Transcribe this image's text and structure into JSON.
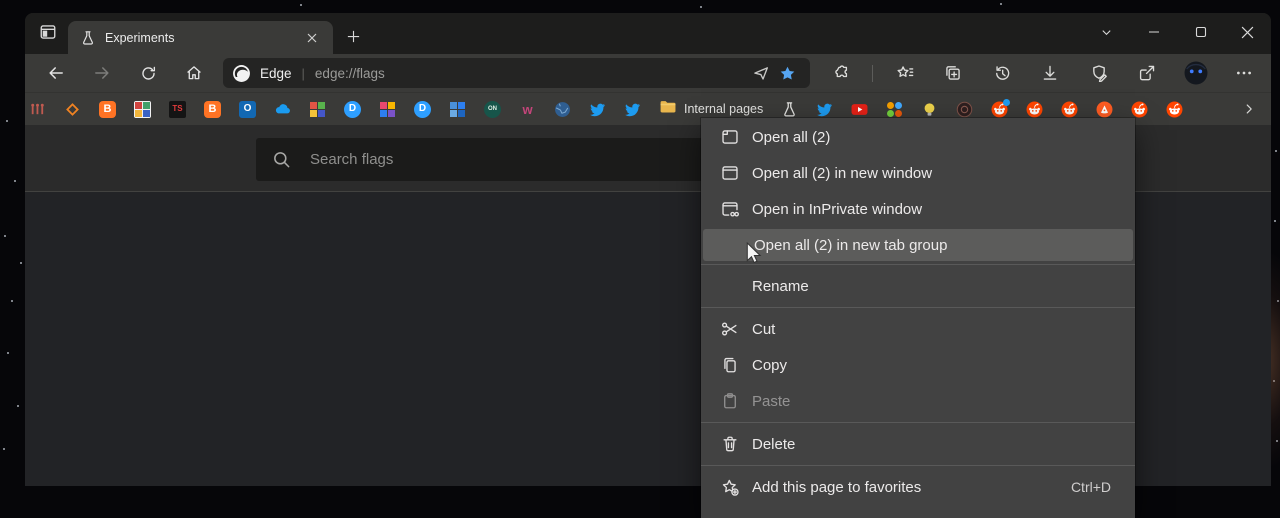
{
  "window": {
    "tab_title": "Experiments",
    "toolbar": {
      "site_label": "Edge",
      "url": "edge://flags",
      "right_icons": [
        {
          "name": "extensions-icon",
          "icon": "puzzle"
        },
        {
          "name": "toolbar-divider",
          "icon": "divider"
        },
        {
          "name": "favorites-icon",
          "icon": "starlines"
        },
        {
          "name": "collections-icon",
          "icon": "collections"
        },
        {
          "name": "history-icon",
          "icon": "history"
        },
        {
          "name": "downloads-icon",
          "icon": "download"
        },
        {
          "name": "browser-essentials-icon",
          "icon": "shieldpencil"
        },
        {
          "name": "share-icon",
          "icon": "share"
        },
        {
          "name": "profile-avatar",
          "icon": "avatar"
        },
        {
          "name": "settings-menu-icon",
          "icon": "dots"
        }
      ]
    }
  },
  "bookmarks_bar": {
    "folder_label": "Internal pages",
    "favicons_before_folder": [
      {
        "name": "matchsticks-favicon",
        "render": {
          "type": "icon",
          "icon": "pins"
        }
      },
      {
        "name": "orange-diamond-favicon",
        "render": {
          "type": "icon",
          "icon": "diamond"
        }
      },
      {
        "name": "blogger-favicon",
        "render": {
          "type": "text",
          "bg": "#ff7324",
          "fg": "#ffffff",
          "text": "B",
          "radius": "4px",
          "size": "11px",
          "bold": true
        }
      },
      {
        "name": "mosaic-thumbnail-favicon",
        "render": {
          "type": "grid",
          "colors": [
            "#d0443f",
            "#43a06a",
            "#f2b63c",
            "#3a62c4"
          ],
          "bg": "#f2f2f2"
        }
      },
      {
        "name": "ts-favicon",
        "render": {
          "type": "text",
          "bg": "#141414",
          "fg": "#e23b3b",
          "text": "TS",
          "radius": "2px",
          "size": "8px",
          "bold": true
        }
      },
      {
        "name": "blogger2-favicon",
        "render": {
          "type": "text",
          "bg": "#ff7324",
          "fg": "#ffffff",
          "text": "B",
          "radius": "4px",
          "size": "11px",
          "bold": true
        }
      },
      {
        "name": "outlook-favicon",
        "render": {
          "type": "text",
          "bg": "#1268b3",
          "fg": "#ffffff",
          "text": "O",
          "radius": "3px",
          "size": "10px",
          "bold": true
        }
      },
      {
        "name": "onedrive-favicon",
        "render": {
          "type": "icon",
          "icon": "cloud"
        }
      },
      {
        "name": "mosaic2-favicon",
        "render": {
          "type": "grid",
          "colors": [
            "#e05545",
            "#58b24c",
            "#f4c23a",
            "#4456c8"
          ]
        }
      },
      {
        "name": "disqus-favicon",
        "render": {
          "type": "text",
          "bg": "#2e9fff",
          "fg": "#ffffff",
          "text": "D",
          "radius": "50%",
          "size": "10px",
          "bold": true
        }
      },
      {
        "name": "color-squares-favicon",
        "render": {
          "type": "grid",
          "colors": [
            "#e8486e",
            "#f7b500",
            "#2d7ff0",
            "#7a52c7"
          ]
        }
      },
      {
        "name": "disqus2-favicon",
        "render": {
          "type": "text",
          "bg": "#2e9fff",
          "fg": "#ffffff",
          "text": "D",
          "radius": "50%",
          "size": "10px",
          "bold": true
        }
      },
      {
        "name": "microsoft-squares-favicon",
        "render": {
          "type": "grid",
          "colors": [
            "#4a90d9",
            "#2d7ff0",
            "#6aaae4",
            "#1d65c0"
          ]
        }
      },
      {
        "name": "on-circle-favicon",
        "render": {
          "type": "text",
          "bg": "#17554a",
          "fg": "#dff0e6",
          "text": "ON",
          "radius": "50%",
          "size": "6px",
          "bold": true
        }
      },
      {
        "name": "w-colorful-favicon",
        "render": {
          "type": "text",
          "bg": "transparent",
          "fg": "#c4457a",
          "text": "w",
          "radius": "0",
          "size": "13px",
          "bold": true
        }
      },
      {
        "name": "globe-favicon",
        "render": {
          "type": "icon",
          "icon": "globe"
        }
      },
      {
        "name": "twitter-favicon",
        "render": {
          "type": "icon",
          "icon": "bird"
        }
      },
      {
        "name": "twitter2-favicon",
        "render": {
          "type": "icon",
          "icon": "bird"
        }
      }
    ],
    "favicons_after_folder": [
      {
        "name": "flags-beaker-favicon",
        "render": {
          "type": "icon",
          "icon": "beaker"
        }
      },
      {
        "name": "twitter3-favicon",
        "render": {
          "type": "icon",
          "icon": "bird"
        }
      },
      {
        "name": "youtube-favicon",
        "render": {
          "type": "icon",
          "icon": "youtube"
        }
      },
      {
        "name": "people-group-favicon",
        "render": {
          "type": "grid",
          "colors": [
            "#f59f00",
            "#40a9ff",
            "#73d13d",
            "#e8590c"
          ],
          "round": true
        }
      },
      {
        "name": "lightbulb-favicon",
        "render": {
          "type": "icon",
          "icon": "bulb"
        }
      },
      {
        "name": "dark-logo-favicon",
        "render": {
          "type": "icon",
          "icon": "darkball"
        }
      },
      {
        "name": "reddit-notification-favicon",
        "render": {
          "type": "icon",
          "icon": "reddit",
          "dot": true
        }
      },
      {
        "name": "reddit2-favicon",
        "render": {
          "type": "icon",
          "icon": "reddit"
        }
      },
      {
        "name": "reddit3-favicon",
        "render": {
          "type": "icon",
          "icon": "reddit"
        }
      },
      {
        "name": "pizza-favicon",
        "render": {
          "type": "icon",
          "icon": "pizza"
        }
      },
      {
        "name": "reddit4-favicon",
        "render": {
          "type": "icon",
          "icon": "reddit"
        }
      },
      {
        "name": "reddit5-favicon",
        "render": {
          "type": "icon",
          "icon": "reddit"
        }
      }
    ]
  },
  "page": {
    "search_placeholder": "Search flags"
  },
  "context_menu": {
    "items": [
      {
        "name": "open-all",
        "icon": "tab",
        "label": "Open all (2)"
      },
      {
        "name": "open-all-new-window",
        "icon": "window",
        "label": "Open all (2) in new window"
      },
      {
        "name": "open-inprivate",
        "icon": "inprivate",
        "label": "Open in InPrivate window"
      },
      {
        "name": "open-all-new-tab-group",
        "label": "Open all (2) in new tab group",
        "highlighted": true
      },
      {
        "type": "separator"
      },
      {
        "name": "rename",
        "label": "Rename"
      },
      {
        "type": "separator"
      },
      {
        "name": "cut",
        "icon": "scissors",
        "label": "Cut"
      },
      {
        "name": "copy",
        "icon": "copy",
        "label": "Copy"
      },
      {
        "name": "paste",
        "icon": "paste",
        "label": "Paste",
        "disabled": true
      },
      {
        "type": "separator"
      },
      {
        "name": "delete",
        "icon": "trash",
        "label": "Delete"
      },
      {
        "type": "separator"
      },
      {
        "name": "add-page-favorites",
        "icon": "starplus",
        "label": "Add this page to favorites",
        "shortcut": "Ctrl+D"
      }
    ]
  }
}
